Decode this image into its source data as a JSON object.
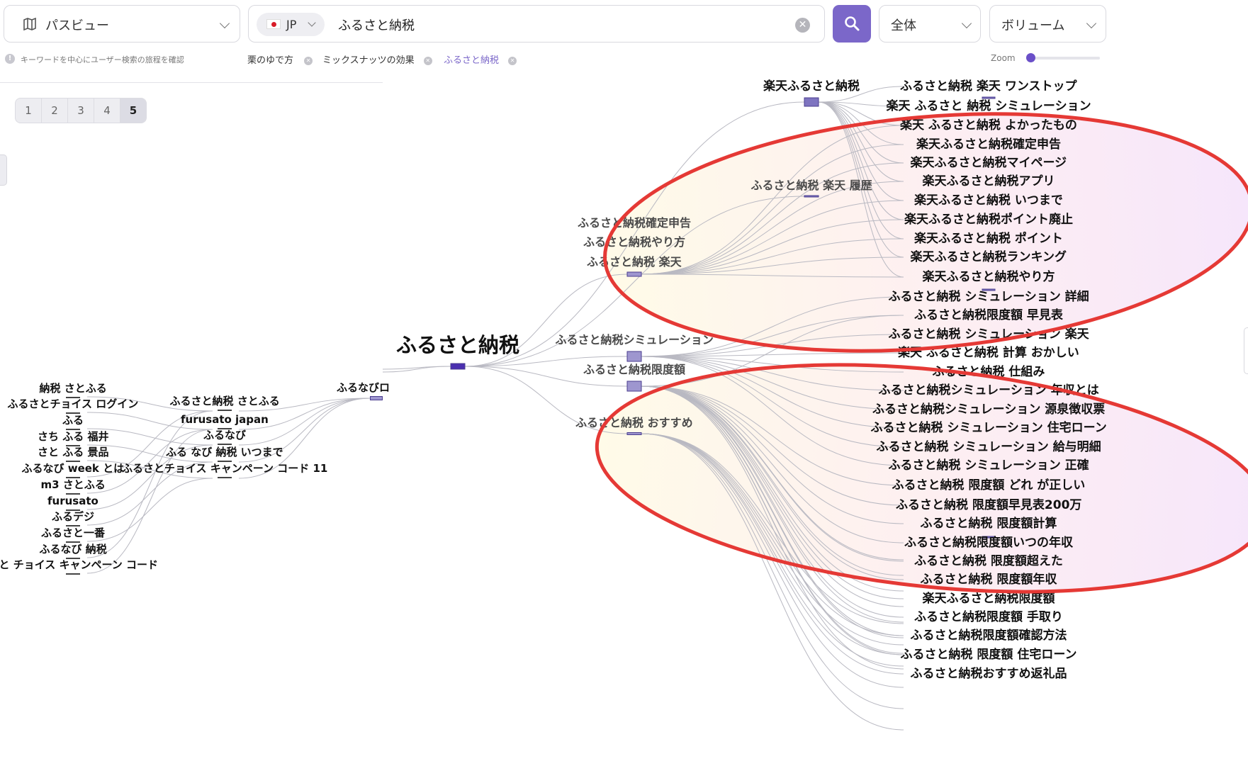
{
  "toolbar": {
    "view_select": "パスビュー",
    "country": "JP",
    "search_value": "ふるさと納税",
    "scope_select": "全体",
    "metric_select": "ボリューム",
    "hint": "キーワードを中心にユーザー検索の旅程を確認",
    "history_tags": [
      "栗のゆで方",
      "ミックスナッツの効果",
      "ふるさと納税"
    ],
    "zoom_label": "Zoom"
  },
  "pagination": {
    "pages": [
      "1",
      "2",
      "3",
      "4",
      "5"
    ],
    "active": "5"
  },
  "graph": {
    "center": "ふるさと納税",
    "left_group": {
      "outer": [
        "納税 さとふる",
        "ふるさとチョイス ログイン",
        "ふる",
        "さち ふる 福井",
        "さと ふる 景品",
        "ふるなび week とは",
        "m3 さとふる",
        "furusato",
        "ふるデジ",
        "ふるさと一番",
        "ふるなび 納税",
        "さと チョイス キャンペーン コード"
      ],
      "middle": [
        "ふるさと納税 さとふる",
        "furusato japan",
        "ふるなび",
        "ふる なび 納税 いつまで",
        "ふるさとチョイス キャンペーン コード 11"
      ],
      "inner": "ふるなびロ"
    },
    "mid_nodes": [
      "ふるさと納税確定申告",
      "ふるさと納税やり方",
      "ふるさと納税 楽天",
      "ふるさと納税シミュレーション",
      "ふるさと納税限度額",
      "ふるさと納税 おすすめ"
    ],
    "upper_mid": [
      "楽天ふるさと納税",
      "ふるさと納税 楽天 履歴"
    ],
    "right_list": [
      "ふるさと納税 楽天 ワンストップ",
      "楽天 ふるさと 納税 シミュレーション",
      "楽天 ふるさと納税 よかったもの",
      "楽天ふるさと納税確定申告",
      "楽天ふるさと納税マイページ",
      "楽天ふるさと納税アプリ",
      "楽天ふるさと納税 いつまで",
      "楽天ふるさと納税ポイント廃止",
      "楽天ふるさと納税 ポイント",
      "楽天ふるさと納税ランキング",
      "楽天ふるさと納税やり方",
      "ふるさと納税 シミュレーション 詳細",
      "ふるさと納税限度額 早見表",
      "ふるさと納税 シミュレーション 楽天",
      "楽天 ふるさと納税 計算 おかしい",
      "ふるさと納税 仕組み",
      "ふるさと納税シミュレーション 年収とは",
      "ふるさと納税シミュレーション 源泉徴収票",
      "ふるさと納税 シミュレーション 住宅ローン",
      "ふるさと納税 シミュレーション 給与明細",
      "ふるさと納税 シミュレーション 正確",
      "ふるさと納税 限度額 どれ が正しい",
      "ふるさと納税 限度額早見表200万",
      "ふるさと納税 限度額計算",
      "ふるさと納税限度額いつの年収",
      "ふるさと納税 限度額超えた",
      "ふるさと納税 限度額年収",
      "楽天ふるさと納税限度額",
      "ふるさと納税限度額 手取り",
      "ふるさと納税限度額確認方法",
      "ふるさと納税 限度額 住宅ローン",
      "ふるさと納税おすすめ返礼品"
    ]
  },
  "colors": {
    "accent": "#7b67c9",
    "annotation": "#e53935",
    "node": "#8a7fc4",
    "center_node": "#4b2fb0"
  }
}
